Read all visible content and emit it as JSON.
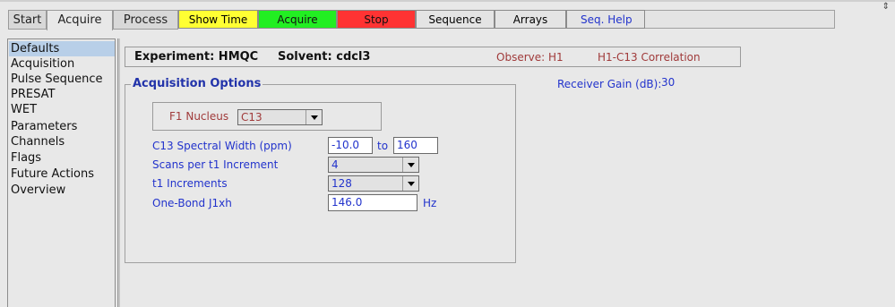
{
  "tabs": [
    {
      "label": "Start"
    },
    {
      "label": "Acquire"
    },
    {
      "label": "Process"
    }
  ],
  "toolbar": {
    "show_time": "Show Time",
    "acquire": "Acquire",
    "stop": "Stop",
    "sequence": "Sequence",
    "arrays": "Arrays",
    "seq_help": "Seq. Help"
  },
  "sidebar": {
    "items": [
      {
        "label": "Defaults",
        "selected": true
      },
      {
        "label": "Acquisition"
      },
      {
        "label": "Pulse Sequence"
      },
      {
        "label": "PRESAT"
      },
      {
        "label": "WET"
      },
      {
        "label": "Parameters"
      },
      {
        "label": "Channels"
      },
      {
        "label": "Flags"
      },
      {
        "label": "Future Actions"
      },
      {
        "label": "Overview"
      }
    ]
  },
  "header": {
    "experiment": "Experiment: HMQC",
    "solvent": "Solvent: cdcl3",
    "observe": "Observe: H1",
    "correlation": "H1-C13 Correlation"
  },
  "acquisition": {
    "title": "Acquisition Options",
    "f1_nucleus_label": "F1 Nucleus",
    "f1_nucleus_value": "C13",
    "spectral_width_label": "C13 Spectral Width (ppm)",
    "spectral_width_from": "-10.0",
    "spectral_width_to_label": "to",
    "spectral_width_to": "160",
    "scans_label": "Scans per t1 Increment",
    "scans_value": "4",
    "t1_label": "t1 Increments",
    "t1_value": "128",
    "j1xh_label": "One-Bond J1xh",
    "j1xh_value": "146.0",
    "j1xh_unit": "Hz"
  },
  "receiver_gain": {
    "label": "Receiver Gain (dB):",
    "value": "30"
  },
  "colors": {
    "accent_blue": "#2233cc",
    "label_red": "#a03a3a",
    "show_time_yellow": "#ffff33",
    "acquire_green": "#22ee22",
    "stop_red": "#ff3333",
    "selection_blue": "#b8cfe8"
  }
}
